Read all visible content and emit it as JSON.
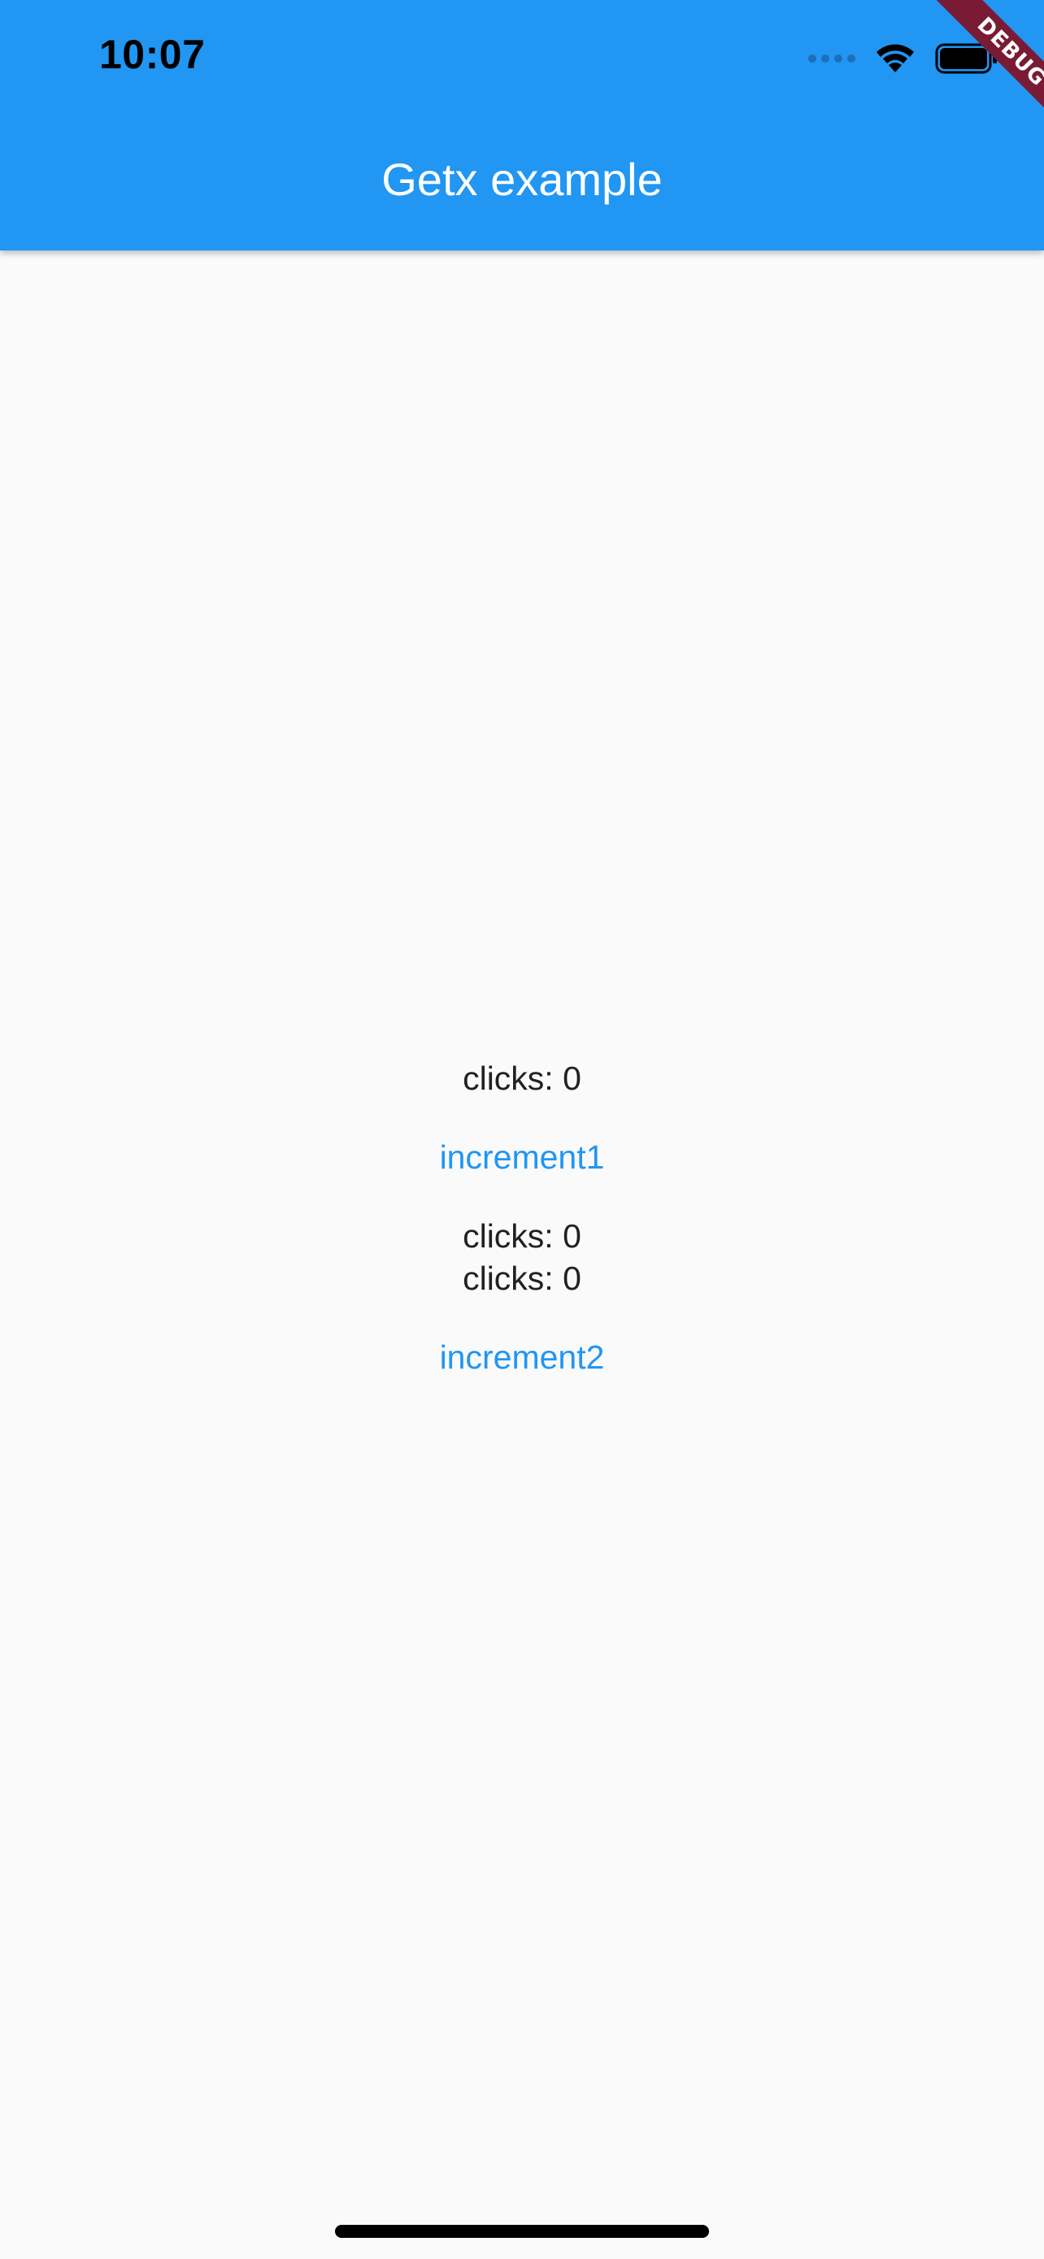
{
  "status_bar": {
    "time": "10:07"
  },
  "app_bar": {
    "title": "Getx example",
    "color": "#2196f3"
  },
  "debug_banner": {
    "label": "DEBUG",
    "color": "#7a1b36"
  },
  "content": {
    "clicks1": "clicks: 0",
    "increment1_label": "increment1",
    "clicks2": "clicks: 0",
    "clicks3": "clicks: 0",
    "increment2_label": "increment2",
    "button_color": "#2196f3"
  },
  "icons": [
    "signal-icon",
    "wifi-icon",
    "battery-icon"
  ]
}
